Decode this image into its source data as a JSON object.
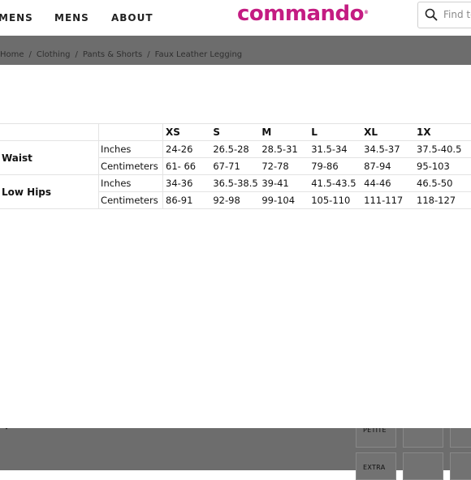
{
  "header": {
    "nav": [
      "MENS",
      "MENS",
      "ABOUT"
    ],
    "logo": "commando",
    "logo_mark": "®",
    "search_placeholder": "Find to"
  },
  "breadcrumb": {
    "items": [
      "Home",
      "Clothing",
      "Pants & Shorts",
      "Faux Leather Legging"
    ],
    "separator": "/"
  },
  "size_chart": {
    "sizes": [
      "XS",
      "S",
      "M",
      "L",
      "XL",
      "1X"
    ],
    "rows": [
      {
        "metric": "Waist",
        "unit": "Inches",
        "values": [
          "24-26",
          "26.5-28",
          "28.5-31",
          "31.5-34",
          "34.5-37",
          "37.5-40.5"
        ]
      },
      {
        "metric": "",
        "unit": "Centimeters",
        "values": [
          "61- 66",
          "67-71",
          "72-78",
          "79-86",
          "87-94",
          "95-103"
        ]
      },
      {
        "metric": "Low Hips",
        "unit": "Inches",
        "values": [
          "34-36",
          "36.5-38.5",
          "39-41",
          "41.5-43.5",
          "44-46",
          "46.5-50"
        ]
      },
      {
        "metric": "",
        "unit": "Centimeters",
        "values": [
          "86-91",
          "92-98",
          "99-104",
          "105-110",
          "111-117",
          "118-127"
        ]
      }
    ]
  },
  "size_options": [
    "PETITE",
    "EXTRA"
  ],
  "colors": {
    "brand": "#c41c82",
    "overlay": "#6d6d6d"
  }
}
